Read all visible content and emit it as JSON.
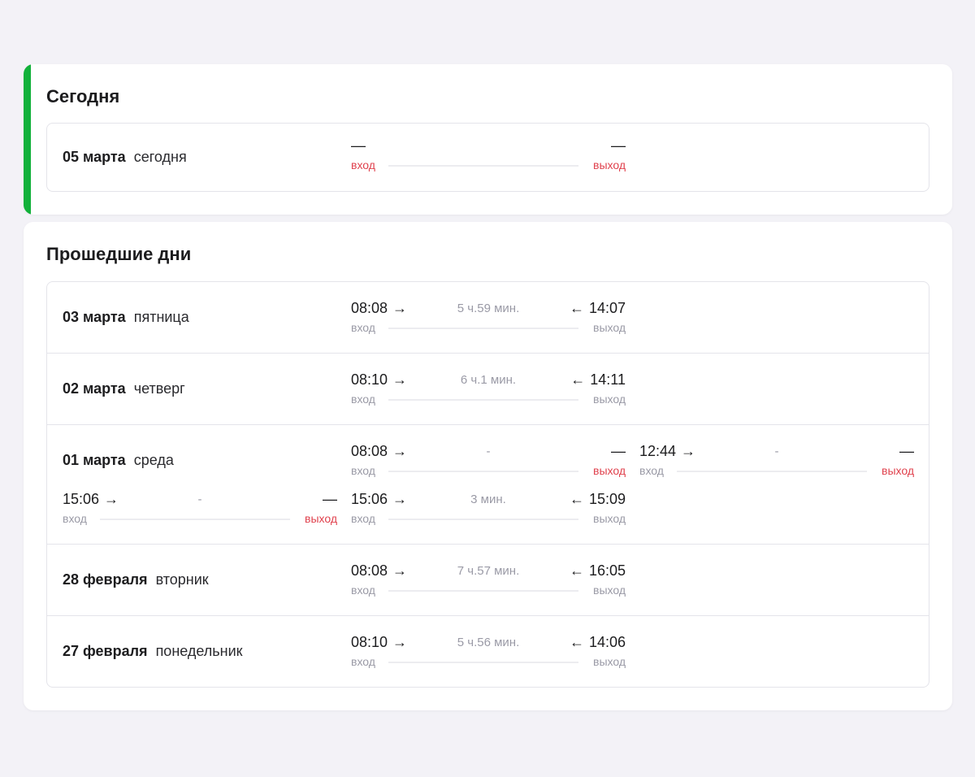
{
  "colors": {
    "accent": "#12b13a",
    "missing": "#e0424e",
    "muted": "#9a9aa6"
  },
  "today": {
    "title": "Сегодня",
    "date": "05 марта",
    "weekday": "сегодня",
    "entry_time": "—",
    "exit_time": "—",
    "entry_label": "вход",
    "exit_label": "выход"
  },
  "past": {
    "title": "Прошедшие дни",
    "days": [
      {
        "date": "03 марта",
        "weekday": "пятница",
        "sessions": [
          {
            "in": "08:08",
            "duration": "5 ч.59 мин.",
            "out": "14:07",
            "in_label": "вход",
            "out_label": "выход"
          }
        ]
      },
      {
        "date": "02 марта",
        "weekday": "четверг",
        "sessions": [
          {
            "in": "08:10",
            "duration": "6 ч.1 мин.",
            "out": "14:11",
            "in_label": "вход",
            "out_label": "выход"
          }
        ]
      },
      {
        "date": "01 марта",
        "weekday": "среда",
        "sessions": [
          {
            "in": "08:08",
            "duration": "-",
            "out": "—",
            "in_label": "вход",
            "out_label": "выход"
          },
          {
            "in": "12:44",
            "duration": "-",
            "out": "—",
            "in_label": "вход",
            "out_label": "выход"
          },
          {
            "in": "15:06",
            "duration": "-",
            "out": "—",
            "in_label": "вход",
            "out_label": "выход"
          },
          {
            "in": "15:06",
            "duration": "3 мин.",
            "out": "15:09",
            "in_label": "вход",
            "out_label": "выход"
          }
        ]
      },
      {
        "date": "28 февраля",
        "weekday": "вторник",
        "sessions": [
          {
            "in": "08:08",
            "duration": "7 ч.57 мин.",
            "out": "16:05",
            "in_label": "вход",
            "out_label": "выход"
          }
        ]
      },
      {
        "date": "27 февраля",
        "weekday": "понедельник",
        "sessions": [
          {
            "in": "08:10",
            "duration": "5 ч.56 мин.",
            "out": "14:06",
            "in_label": "вход",
            "out_label": "выход"
          }
        ]
      }
    ]
  }
}
